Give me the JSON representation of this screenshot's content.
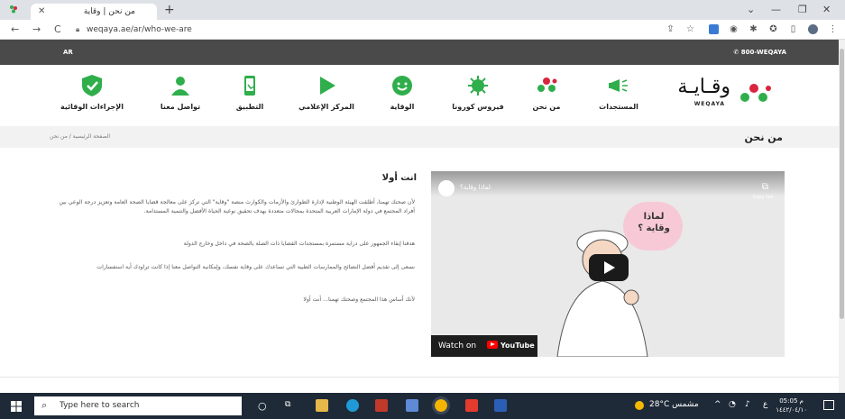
{
  "browser": {
    "tab_title": "من نحن | وقاية",
    "tab_close": "✕",
    "new_tab": "+",
    "url": "weqaya.ae/ar/who-we-are",
    "back": "←",
    "forward": "→",
    "reload": "C",
    "minimize": "—",
    "restore": "❐",
    "close": "✕",
    "chevron": "⌄"
  },
  "site": {
    "lang_toggle": "AR",
    "phone": "800-WEQAYA",
    "logo_ar": "وقـايـة",
    "logo_en": "WEQAYA",
    "nav": [
      {
        "label": "المستجدات"
      },
      {
        "label": "من نحن"
      },
      {
        "label": "فيروس كورونا"
      },
      {
        "label": "الوقاية"
      },
      {
        "label": "المركز الإعلامي"
      },
      {
        "label": "التطبيق"
      },
      {
        "label": "تواصل معنا"
      },
      {
        "label": "الإجراءات الوقائية"
      }
    ],
    "colors": {
      "green": "#2fae4b",
      "red": "#d7263d",
      "dark": "#4a4a4a"
    }
  },
  "page": {
    "title": "من نحن",
    "breadcrumb": "الصفحة الرئيسية / من نحن",
    "heading": "انت أولا",
    "paragraphs": [
      "لأن صحتك تهمنا، أطلقت الهيئة الوطنية لإدارة الطوارئ والأزمات والكوارث منصة \"وقاية\" التي تركز على معالجة قضايا الصحة العامة وتعزيز درجة الوعي بين أفراد المجتمع في دولة الإمارات العربية المتحدة بمجالات متعددة بهدف تحقيق نوعية الحياة الأفضل والتنمية المستدامة.",
      "هدفنا إبقاء الجمهور على دراية مستمرة بمستجدات القضايا ذات الصلة بالصحة في داخل وخارج الدولة",
      "نسعى إلى تقديم أفضل النصائح والممارسات الطبية التي تساعدك على وقاية نفسك، وإمكانية التواصل معنا إذا كانت تراودك أية استفسارات",
      "لأنك أساس هذا المجتمع وصحتك تهمنا... أنت أولا"
    ]
  },
  "video": {
    "title": "لماذا وقاية؟",
    "bubble_text": "لماذا وقاية ؟",
    "watch_on": "Watch on",
    "youtube": "YouTube",
    "copy_label": "Copy link"
  },
  "taskbar": {
    "search_placeholder": "Type here to search",
    "weather": "28°C  مشمس",
    "time": "05:05 م",
    "date": "١٤٤٢/٠٤/١٠",
    "lang": "ع"
  }
}
